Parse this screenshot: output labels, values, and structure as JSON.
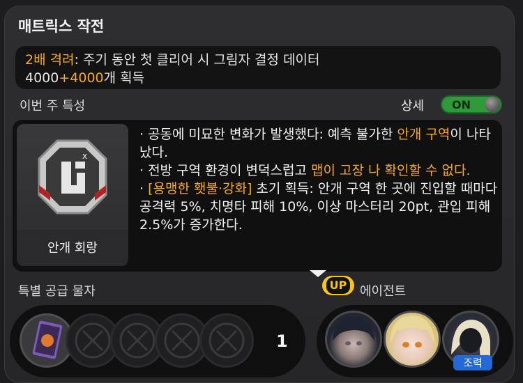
{
  "title": "매트릭스 작전",
  "banner": {
    "prefix": "2배 격려",
    "colon": ": ",
    "text1": "주기 동안 첫 클리어 시 그림자 결정 데이터",
    "base": "4000",
    "bonus": "+4000",
    "text2": "개 획득"
  },
  "weekly_label": "이번 주 특성",
  "detail_label": "상세",
  "toggle_label": "ON",
  "zone_card": {
    "name": "안개 회랑",
    "icon": "fog-corridor-emblem-icon"
  },
  "traits": [
    {
      "pre": "· 공동에 미묘한 변화가 발생했다: 예측 불가한 ",
      "hl": "안개 구역",
      "post": "이 나타났다."
    },
    {
      "pre": "· 전방 구역 환경이 변덕스럽고 ",
      "hl": "맵이 고장 나 확인할 수 없다.",
      "post": ""
    },
    {
      "pre": "· ",
      "hl": "[용맹한 횃불·강화]",
      "post": " 초기 획득: 안개 구역 한 곳에 진입할 때마다 공격력 5%, 치명타 피해 10%, 이상 마스터리 20pt, 관입 피해 2.5%가 증가한다."
    }
  ],
  "supply_label": "특별 공급 물자",
  "supply_count": "1",
  "up_label": "UP",
  "agent_label": "에이전트",
  "support_tag": "조력",
  "colors": {
    "accent": "#f7a823",
    "toggle_on": "#2f9a3a",
    "up_badge": "#f6c51b",
    "support": "#2468d8"
  }
}
